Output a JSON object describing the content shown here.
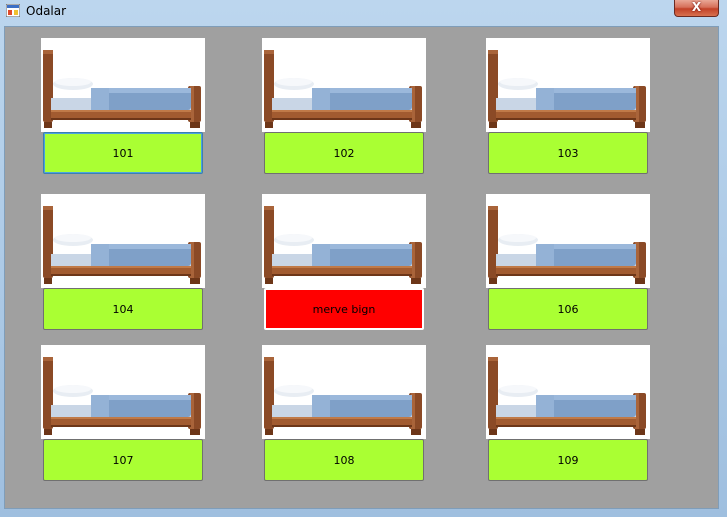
{
  "window": {
    "title": "Odalar",
    "close_label": "X",
    "app_icon": "form-icon"
  },
  "colors": {
    "client_background": "#a0a0a0",
    "available": "#aaff33",
    "occupied": "#ff0000",
    "bed_frame": "#8b4a26",
    "mattress": "#7fa0c8"
  },
  "rooms": [
    {
      "label": "101",
      "status": "available",
      "icon": "bed-icon"
    },
    {
      "label": "102",
      "status": "available",
      "icon": "bed-icon"
    },
    {
      "label": "103",
      "status": "available",
      "icon": "bed-icon"
    },
    {
      "label": "104",
      "status": "available",
      "icon": "bed-icon"
    },
    {
      "label": "merve bign",
      "status": "occupied",
      "icon": "bed-icon"
    },
    {
      "label": "106",
      "status": "available",
      "icon": "bed-icon"
    },
    {
      "label": "107",
      "status": "available",
      "icon": "bed-icon"
    },
    {
      "label": "108",
      "status": "available",
      "icon": "bed-icon"
    },
    {
      "label": "109",
      "status": "available",
      "icon": "bed-icon"
    }
  ]
}
